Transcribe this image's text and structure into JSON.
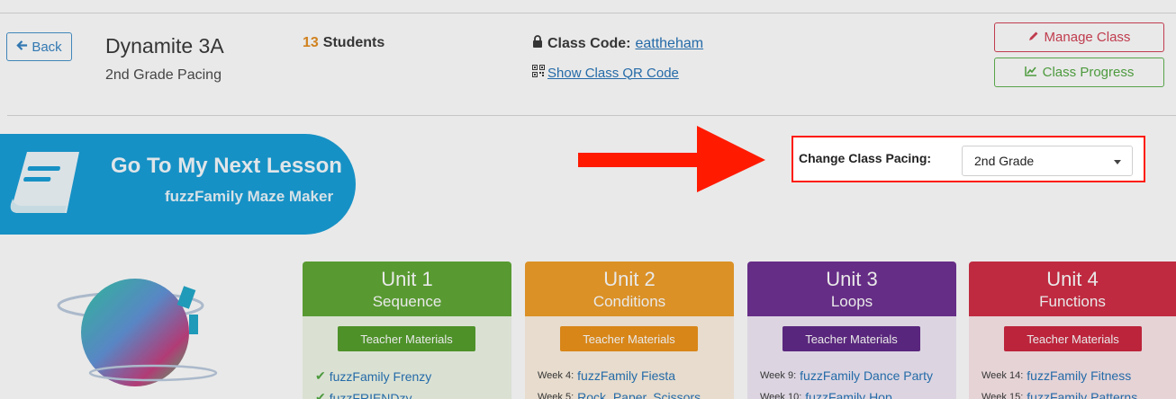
{
  "header": {
    "back_label": "Back",
    "class_name": "Dynamite 3A",
    "pacing_label": "2nd Grade Pacing",
    "students_count": "13",
    "students_label": "Students",
    "class_code_label": "Class Code:",
    "class_code_value": "eattheham",
    "qr_link_label": "Show Class QR Code",
    "manage_label": "Manage Class",
    "progress_label": "Class Progress"
  },
  "next_lesson": {
    "title": "Go To My Next Lesson",
    "subtitle": "fuzzFamily Maze Maker"
  },
  "pacing": {
    "label": "Change Class Pacing:",
    "selected": "2nd Grade"
  },
  "units": [
    {
      "number": "Unit 1",
      "topic": "Sequence",
      "teacher_materials": "Teacher Materials",
      "lessons": [
        {
          "week": "",
          "title": "fuzzFamily Frenzy",
          "completed": true
        },
        {
          "week": "",
          "title": "fuzzFRIENDzy",
          "completed": true
        }
      ]
    },
    {
      "number": "Unit 2",
      "topic": "Conditions",
      "teacher_materials": "Teacher Materials",
      "lessons": [
        {
          "week": "Week 4:",
          "title": "fuzzFamily Fiesta",
          "completed": false
        },
        {
          "week": "Week 5:",
          "title": "Rock, Paper, Scissors",
          "completed": false
        }
      ]
    },
    {
      "number": "Unit 3",
      "topic": "Loops",
      "teacher_materials": "Teacher Materials",
      "lessons": [
        {
          "week": "Week 9:",
          "title": "fuzzFamily Dance Party",
          "completed": false
        },
        {
          "week": "Week 10:",
          "title": "fuzzFamily Hop",
          "completed": false
        }
      ]
    },
    {
      "number": "Unit 4",
      "topic": "Functions",
      "teacher_materials": "Teacher Materials",
      "lessons": [
        {
          "week": "Week 14:",
          "title": "fuzzFamily Fitness",
          "completed": false
        },
        {
          "week": "Week 15:",
          "title": "fuzzFamily Patterns",
          "completed": false
        }
      ]
    }
  ],
  "icons": {
    "back": "arrow-left-icon",
    "lock": "lock-icon",
    "qr": "qr-code-icon",
    "pencil": "pencil-icon",
    "chart": "line-chart-icon",
    "book": "book-icon",
    "check": "check-icon",
    "caret": "caret-down-icon"
  },
  "colors": {
    "brand_blue": "#0f9bd6",
    "highlight_red": "#ff1a00",
    "unit1": "#5aa52e",
    "unit2": "#ef9b22",
    "unit3": "#6a2a8f",
    "unit4": "#d0263f"
  }
}
